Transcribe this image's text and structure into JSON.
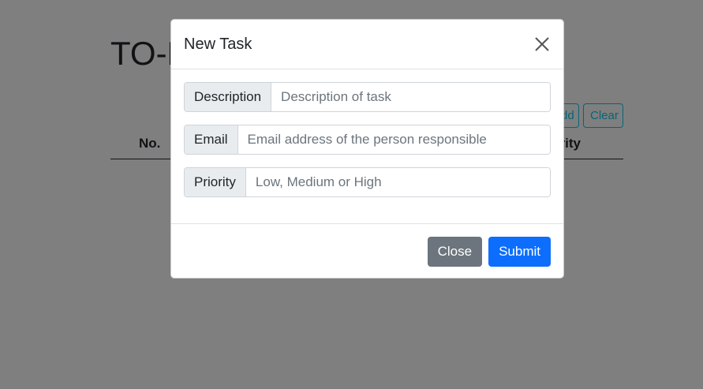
{
  "background": {
    "title": "TO-DO",
    "buttons": {
      "add_label": "Add",
      "clear_label": "Clear"
    },
    "table_headers": {
      "number": "No.",
      "priority": "Priority"
    }
  },
  "modal": {
    "title": "New Task",
    "close_icon": "close-icon",
    "fields": [
      {
        "label": "Description",
        "placeholder": "Description of task",
        "value": ""
      },
      {
        "label": "Email",
        "placeholder": "Email address of the person responsible",
        "value": ""
      },
      {
        "label": "Priority",
        "placeholder": "Low, Medium or High",
        "value": ""
      }
    ],
    "footer": {
      "close_label": "Close",
      "submit_label": "Submit"
    }
  },
  "colors": {
    "primary": "#0d6efd",
    "secondary": "#6c757d",
    "info": "#0dcaf0",
    "backdrop": "rgba(0,0,0,0.5)"
  }
}
